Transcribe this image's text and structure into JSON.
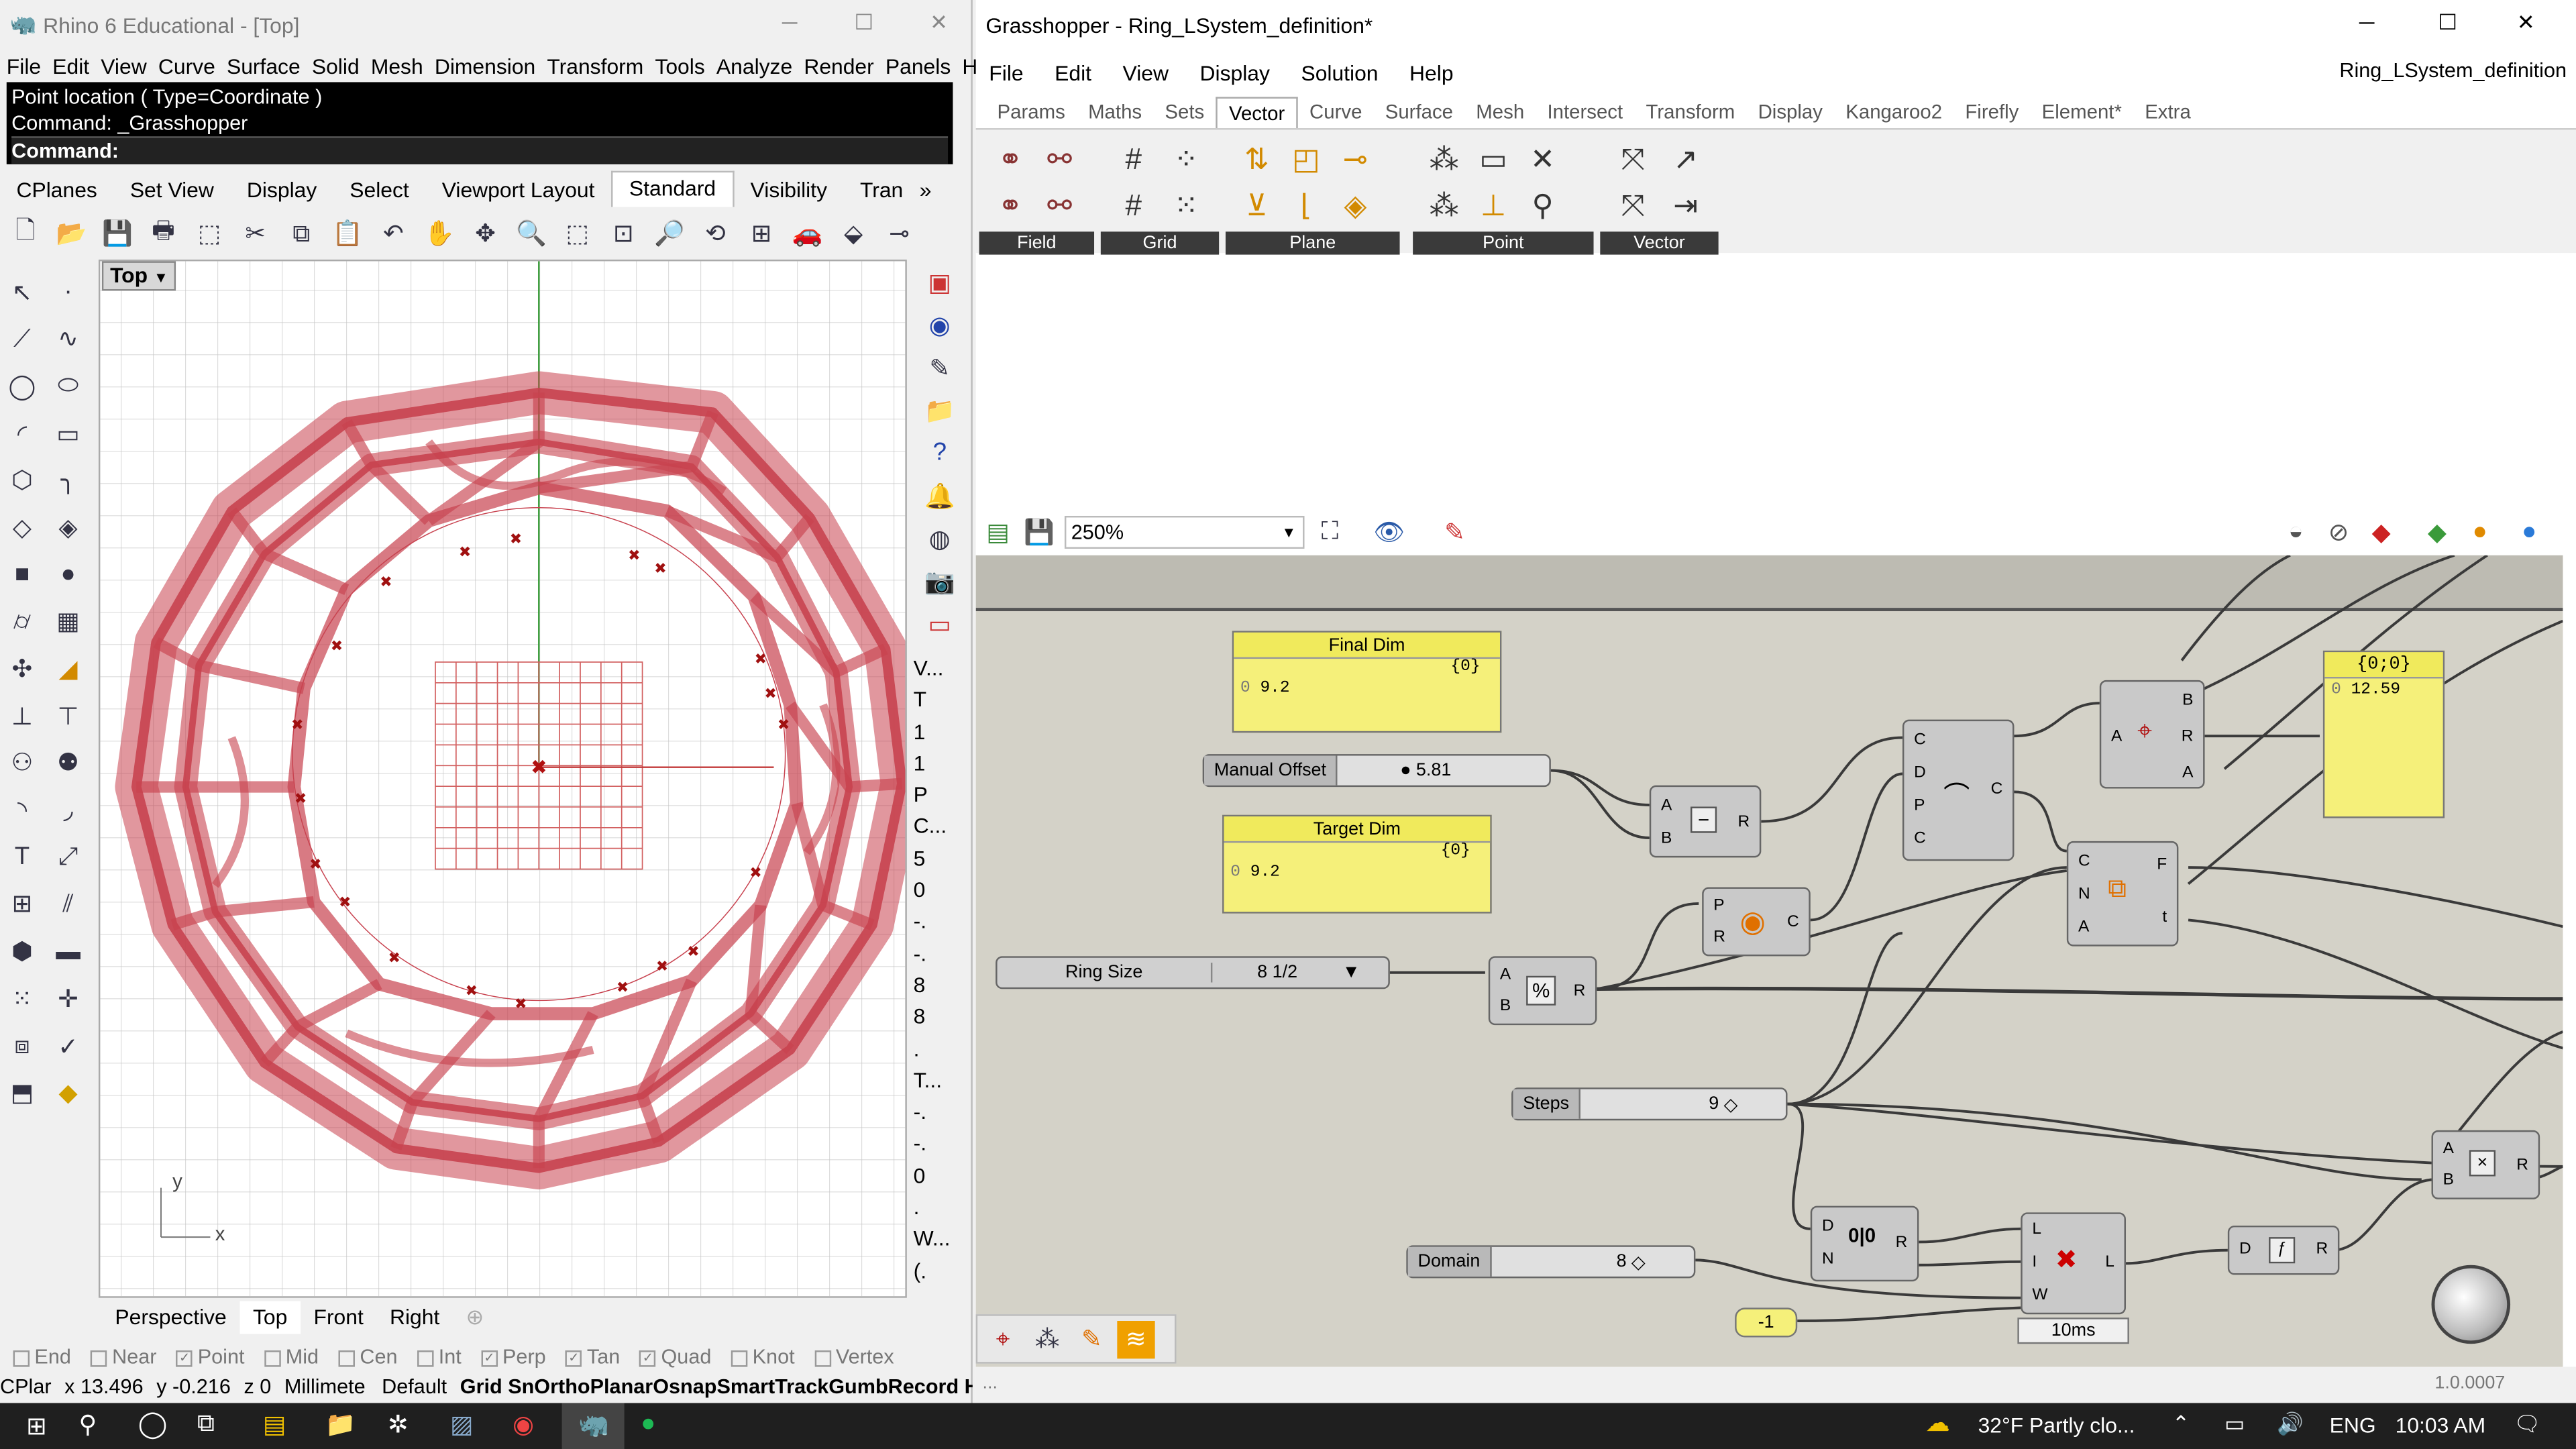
{
  "rhino": {
    "title": "Rhino 6 Educational - [Top]",
    "menu": [
      "File",
      "Edit",
      "View",
      "Curve",
      "Surface",
      "Solid",
      "Mesh",
      "Dimension",
      "Transform",
      "Tools",
      "Analyze",
      "Render",
      "Panels",
      "Help"
    ],
    "command_lines": [
      "Point location ( Type=Coordinate )",
      "Command: _Grasshopper",
      "Command:"
    ],
    "toolbar_tabs": [
      "CPlanes",
      "Set View",
      "Display",
      "Select",
      "Viewport Layout",
      "Standard",
      "Visibility",
      "Tran"
    ],
    "active_tab": "Standard",
    "viewport_label": "Top",
    "viewport_tabs": [
      "Perspective",
      "Top",
      "Front",
      "Right"
    ],
    "axis": {
      "x": "x",
      "y": "y"
    },
    "snaps": [
      {
        "label": "End",
        "checked": false
      },
      {
        "label": "Near",
        "checked": false
      },
      {
        "label": "Point",
        "checked": true
      },
      {
        "label": "Mid",
        "checked": false
      },
      {
        "label": "Cen",
        "checked": false
      },
      {
        "label": "Int",
        "checked": false
      },
      {
        "label": "Perp",
        "checked": true
      },
      {
        "label": "Tan",
        "checked": true
      },
      {
        "label": "Quad",
        "checked": true
      },
      {
        "label": "Knot",
        "checked": false
      },
      {
        "label": "Vertex",
        "checked": false
      }
    ],
    "status": {
      "cplane": "CPlar",
      "x": "x 13.496",
      "y": "y -0.216",
      "z": "z 0",
      "units": "Millimete",
      "layer": "Default",
      "modes": "Grid SnOrthoPlanarOsnapSmartTrackGumbRecord HiFi"
    },
    "right_panel": [
      "V...",
      "T",
      "1",
      "1",
      "P",
      "C...",
      "5",
      "0",
      "-.",
      "-.",
      "8",
      "8",
      ".",
      "T...",
      "-.",
      "-.",
      "0",
      ".",
      "W...",
      "(."
    ],
    "colors": {
      "mesh": "#c8424f",
      "cmd_bg": "#000000"
    }
  },
  "grasshopper": {
    "title": "Grasshopper - Ring_LSystem_definition*",
    "doc_name": "Ring_LSystem_definition",
    "menu": [
      "File",
      "Edit",
      "View",
      "Display",
      "Solution",
      "Help"
    ],
    "tabs": [
      "Params",
      "Maths",
      "Sets",
      "Vector",
      "Curve",
      "Surface",
      "Mesh",
      "Intersect",
      "Transform",
      "Display",
      "Kangaroo2",
      "Firefly",
      "Element*",
      "Extra"
    ],
    "active_tab": "Vector",
    "ribbon_groups": [
      "Field",
      "Grid",
      "Plane",
      "Point",
      "Vector"
    ],
    "zoom": "250%",
    "panels": [
      {
        "name": "Final Dim",
        "path": "{0}",
        "index": "0",
        "value": "9.2"
      },
      {
        "name": "Target Dim",
        "path": "{0}",
        "index": "0",
        "value": "9.2"
      },
      {
        "name": "",
        "path": "{0;0}",
        "index": "0",
        "value": "12.59"
      }
    ],
    "sliders": [
      {
        "name": "Manual Offset",
        "value": "5.81"
      },
      {
        "name": "Steps",
        "value": "9"
      },
      {
        "name": "Domain",
        "value": "8"
      }
    ],
    "value_list": {
      "name": "Ring Size",
      "value": "8 1/2"
    },
    "number": "-1",
    "timer": "10ms",
    "version": "1.0.0007"
  },
  "taskbar": {
    "weather": "32°F  Partly clo...",
    "lang": "ENG",
    "time": "10:03 AM"
  }
}
